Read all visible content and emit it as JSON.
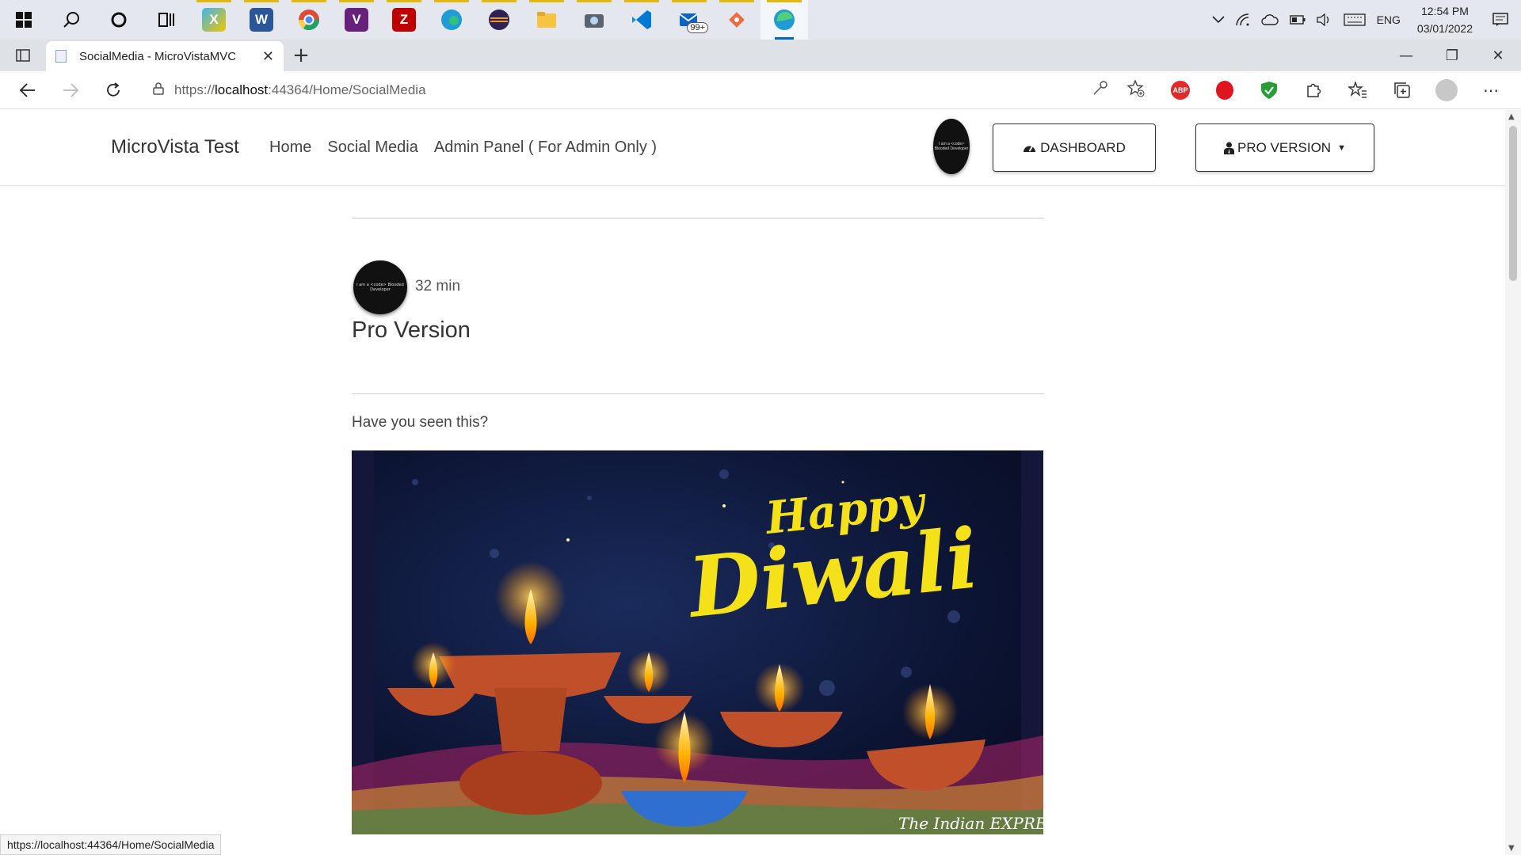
{
  "taskbar": {
    "apps": [
      {
        "name": "start",
        "active": false
      },
      {
        "name": "search",
        "active": false
      },
      {
        "name": "cortana",
        "active": false
      },
      {
        "name": "task-view",
        "active": false
      },
      {
        "name": "app-launcher",
        "active": false
      },
      {
        "name": "word",
        "active": false
      },
      {
        "name": "chrome",
        "active": false
      },
      {
        "name": "visual-studio",
        "active": false
      },
      {
        "name": "filezilla",
        "active": false
      },
      {
        "name": "edge-dev",
        "active": false
      },
      {
        "name": "eclipse",
        "active": false
      },
      {
        "name": "file-explorer",
        "active": false
      },
      {
        "name": "camera",
        "active": false
      },
      {
        "name": "vscode",
        "active": false
      },
      {
        "name": "mail",
        "active": false
      },
      {
        "name": "git-app",
        "active": false
      },
      {
        "name": "edge",
        "active": true
      }
    ],
    "mail_badge": "99+",
    "language": "ENG",
    "time": "12:54 PM",
    "date": "03/01/2022"
  },
  "browser": {
    "tab_title": "SocialMedia - MicroVistaMVC",
    "url_prefix": "https://",
    "url_host": "localhost",
    "url_rest": ":44364/Home/SocialMedia",
    "status_url": "https://localhost:44364/Home/SocialMedia"
  },
  "site": {
    "brand": "MicroVista Test",
    "nav": [
      "Home",
      "Social Media",
      "Admin Panel ( For Admin Only )"
    ],
    "avatar_text": "I am a <code> Blooded Developer",
    "dashboard_label": "DASHBOARD",
    "pro_label": "PRO VERSION"
  },
  "post": {
    "time": "32 min",
    "title": "Pro Version",
    "text": "Have you seen this?",
    "image_text": {
      "line1": "Happy",
      "line2": "Diwali",
      "source": "The Indian EXPRESS"
    }
  },
  "colors": {
    "accent": "#0067c0",
    "diwali_yellow": "#f5e11a",
    "flame": "#ffb300",
    "diya": "#c0502a"
  }
}
